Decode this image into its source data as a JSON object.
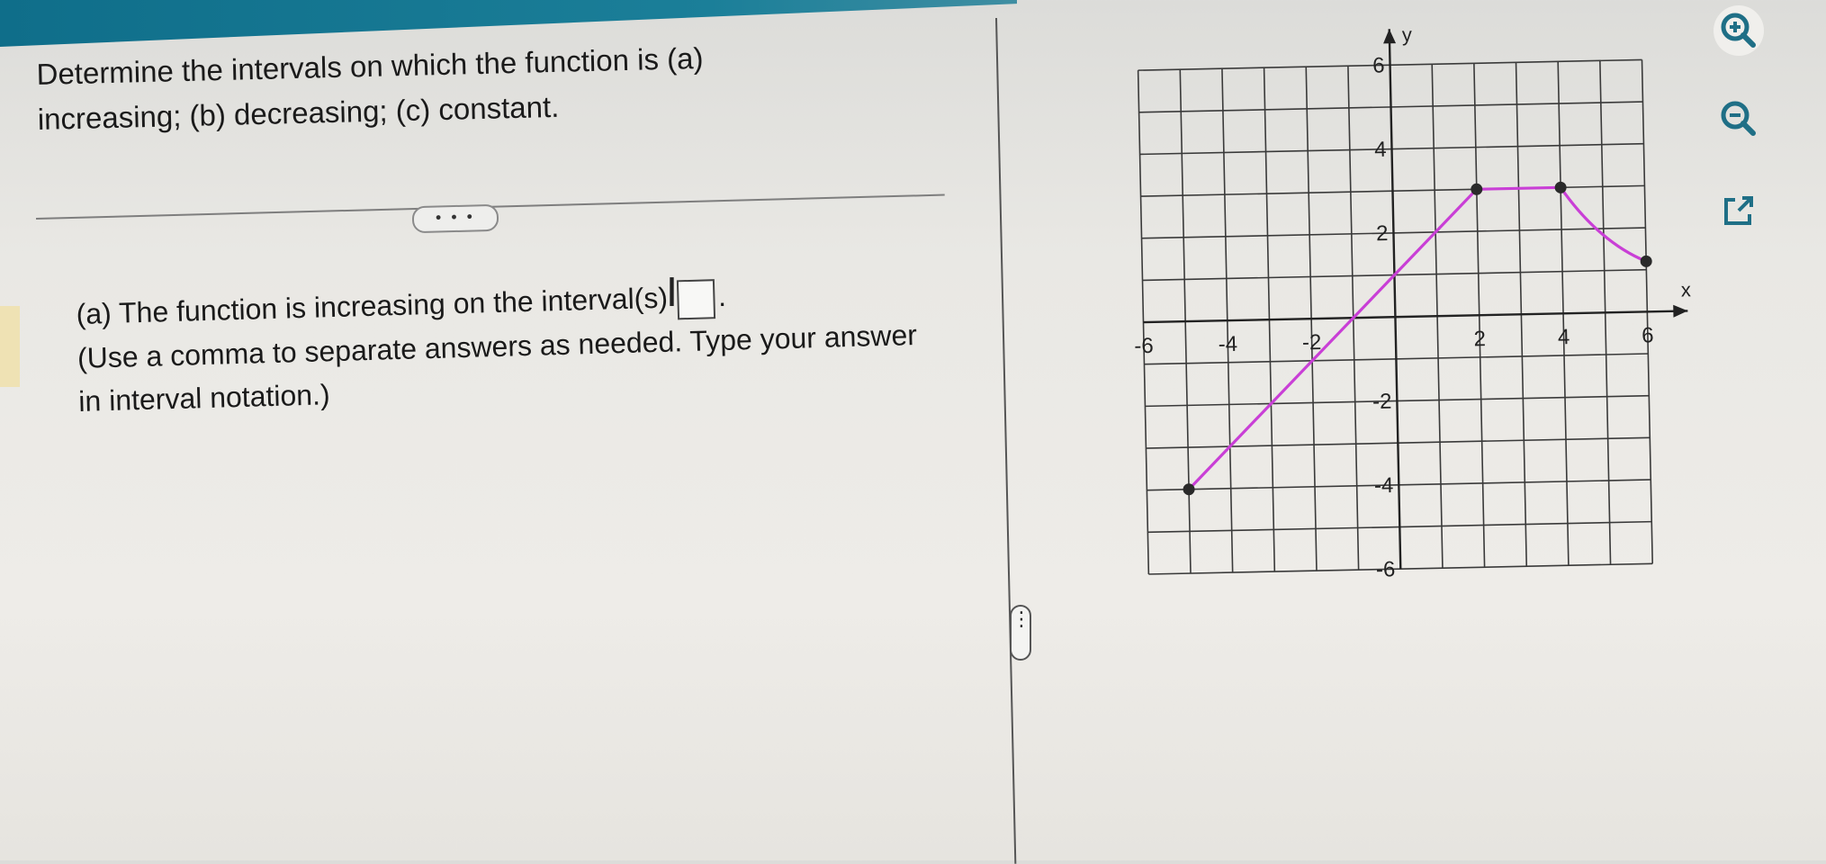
{
  "question": {
    "prompt": "Determine the intervals on which the function is (a) increasing; (b) decreasing; (c) constant."
  },
  "expand_button": {
    "label": "• • •"
  },
  "part_a": {
    "text": "(a) The function is increasing on the interval(s)",
    "end_punct": ".",
    "instructions": "(Use a comma to separate answers as needed. Type your answer in interval notation.)",
    "answer_value": ""
  },
  "splitter": {
    "label": "⋮"
  },
  "colors": {
    "curve": "#c93fd6",
    "grid": "#3a3a3a",
    "header": "#1b7f99"
  },
  "chart_data": {
    "type": "line",
    "title": "",
    "xlabel": "x",
    "ylabel": "y",
    "xlim": [
      -6,
      6
    ],
    "ylim": [
      -6,
      6
    ],
    "grid": true,
    "x_tick_labels": [
      "-6",
      "-4",
      "-2",
      "2",
      "4",
      "6"
    ],
    "y_tick_labels": [
      "6",
      "4",
      "2",
      "-2",
      "-4",
      "-6"
    ],
    "series": [
      {
        "segments": [
          {
            "kind": "linear",
            "points": [
              [
                -5,
                -4
              ],
              [
                2,
                3
              ]
            ]
          },
          {
            "kind": "linear",
            "points": [
              [
                2,
                3
              ],
              [
                4,
                3
              ]
            ]
          },
          {
            "kind": "curve",
            "points": [
              [
                4,
                3
              ],
              [
                4.6,
                2.1
              ],
              [
                5.3,
                1.5
              ],
              [
                6,
                1.2
              ]
            ]
          }
        ],
        "marked_points": [
          [
            -5,
            -4
          ],
          [
            2,
            3
          ],
          [
            4,
            3
          ],
          [
            6,
            1.2
          ]
        ]
      }
    ]
  },
  "tools": {
    "zoom_in_icon": "zoom-in-icon",
    "zoom_out_icon": "zoom-out-icon",
    "popout_icon": "external-link-icon"
  }
}
